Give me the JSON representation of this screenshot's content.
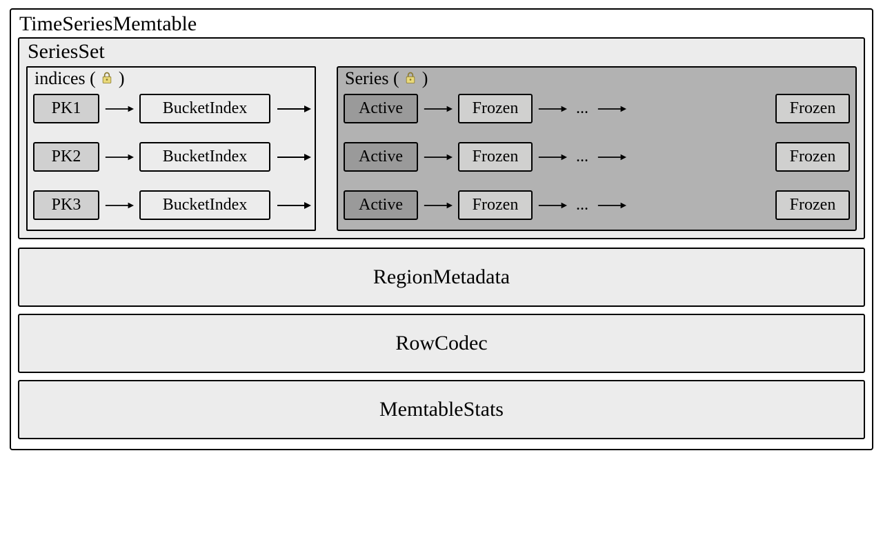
{
  "outer": {
    "title": "TimeSeriesMemtable"
  },
  "seriesset": {
    "title": "SeriesSet"
  },
  "panes": {
    "indices": {
      "title_prefix": "indices ( ",
      "title_suffix": " )",
      "lock": "lock-icon"
    },
    "series": {
      "title_prefix": "Series ( ",
      "title_suffix": " )",
      "lock": "lock-icon"
    }
  },
  "index_rows": [
    {
      "pk": "PK1",
      "bucket": "BucketIndex"
    },
    {
      "pk": "PK2",
      "bucket": "BucketIndex"
    },
    {
      "pk": "PK3",
      "bucket": "BucketIndex"
    }
  ],
  "series_rows": [
    {
      "active": "Active",
      "frozen1": "Frozen",
      "ellipsis": "...",
      "frozen2": "Frozen"
    },
    {
      "active": "Active",
      "frozen1": "Frozen",
      "ellipsis": "...",
      "frozen2": "Frozen"
    },
    {
      "active": "Active",
      "frozen1": "Frozen",
      "ellipsis": "...",
      "frozen2": "Frozen"
    }
  ],
  "wide": {
    "region": "RegionMetadata",
    "codec": "RowCodec",
    "stats": "MemtableStats"
  }
}
